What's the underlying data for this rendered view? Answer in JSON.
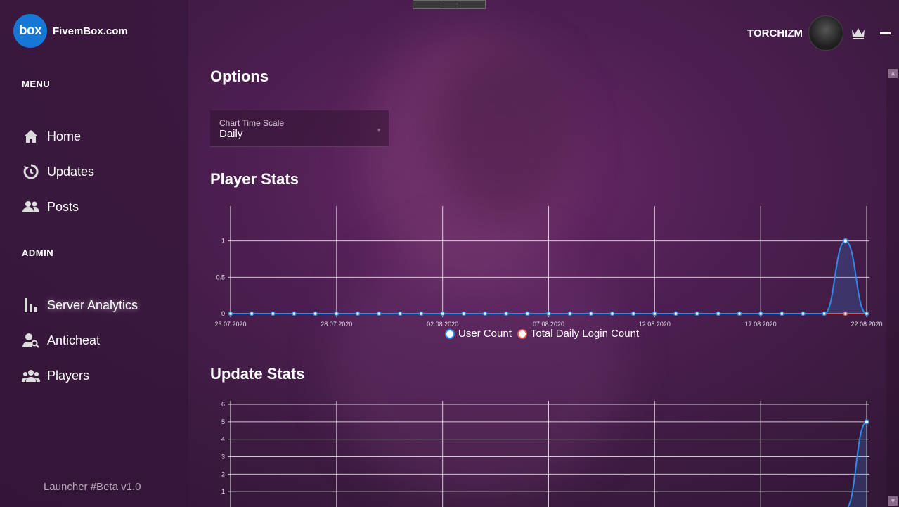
{
  "app": {
    "logo_badge": "box",
    "brand": "FivemBox.com",
    "version": "Launcher #Beta v1.0"
  },
  "user": {
    "name": "TORCHIZM"
  },
  "sidebar": {
    "menu_title": "MENU",
    "menu_items": [
      {
        "label": "Home",
        "icon": "home-icon"
      },
      {
        "label": "Updates",
        "icon": "updates-icon"
      },
      {
        "label": "Posts",
        "icon": "posts-icon"
      }
    ],
    "admin_title": "ADMIN",
    "admin_items": [
      {
        "label": "Server Analytics",
        "icon": "bar-chart-icon",
        "active": true
      },
      {
        "label": "Anticheat",
        "icon": "user-search-icon"
      },
      {
        "label": "Players",
        "icon": "players-icon"
      }
    ]
  },
  "main": {
    "options_title": "Options",
    "time_scale": {
      "caption": "Chart Time Scale",
      "value": "Daily"
    },
    "player_stats_title": "Player Stats",
    "update_stats_title": "Update Stats"
  },
  "colors": {
    "user_count": "#2e8be6",
    "login_count": "#e05a5a",
    "accent": "#1677d6"
  },
  "chart_data": [
    {
      "type": "line",
      "x_ticks": [
        "23.07.2020",
        "28.07.2020",
        "02.08.2020",
        "07.08.2020",
        "12.08.2020",
        "17.08.2020",
        "22.08.2020"
      ],
      "y_ticks": [
        "0",
        "0.5",
        "1"
      ],
      "ylim": [
        0,
        1.2
      ],
      "x_count": 31,
      "series": [
        {
          "name": "User Count",
          "values": [
            0,
            0,
            0,
            0,
            0,
            0,
            0,
            0,
            0,
            0,
            0,
            0,
            0,
            0,
            0,
            0,
            0,
            0,
            0,
            0,
            0,
            0,
            0,
            0,
            0,
            0,
            0,
            0,
            0,
            1,
            0
          ]
        },
        {
          "name": "Total Daily Login Count",
          "values": [
            0,
            0,
            0,
            0,
            0,
            0,
            0,
            0,
            0,
            0,
            0,
            0,
            0,
            0,
            0,
            0,
            0,
            0,
            0,
            0,
            0,
            0,
            0,
            0,
            0,
            0,
            0,
            0,
            0,
            0,
            0
          ]
        }
      ],
      "legend": "bottom"
    },
    {
      "type": "line",
      "y_ticks": [
        "1",
        "2",
        "3",
        "4",
        "5",
        "6"
      ],
      "ylim": [
        0,
        6
      ],
      "x_count": 31,
      "series": [
        {
          "values": [
            0,
            0,
            0,
            0,
            0,
            0,
            0,
            0,
            0,
            0,
            0,
            0,
            0,
            0,
            0,
            0,
            0,
            0,
            0,
            0,
            0,
            0,
            0,
            0,
            0,
            0,
            0,
            0,
            0,
            0,
            5
          ]
        }
      ]
    }
  ]
}
